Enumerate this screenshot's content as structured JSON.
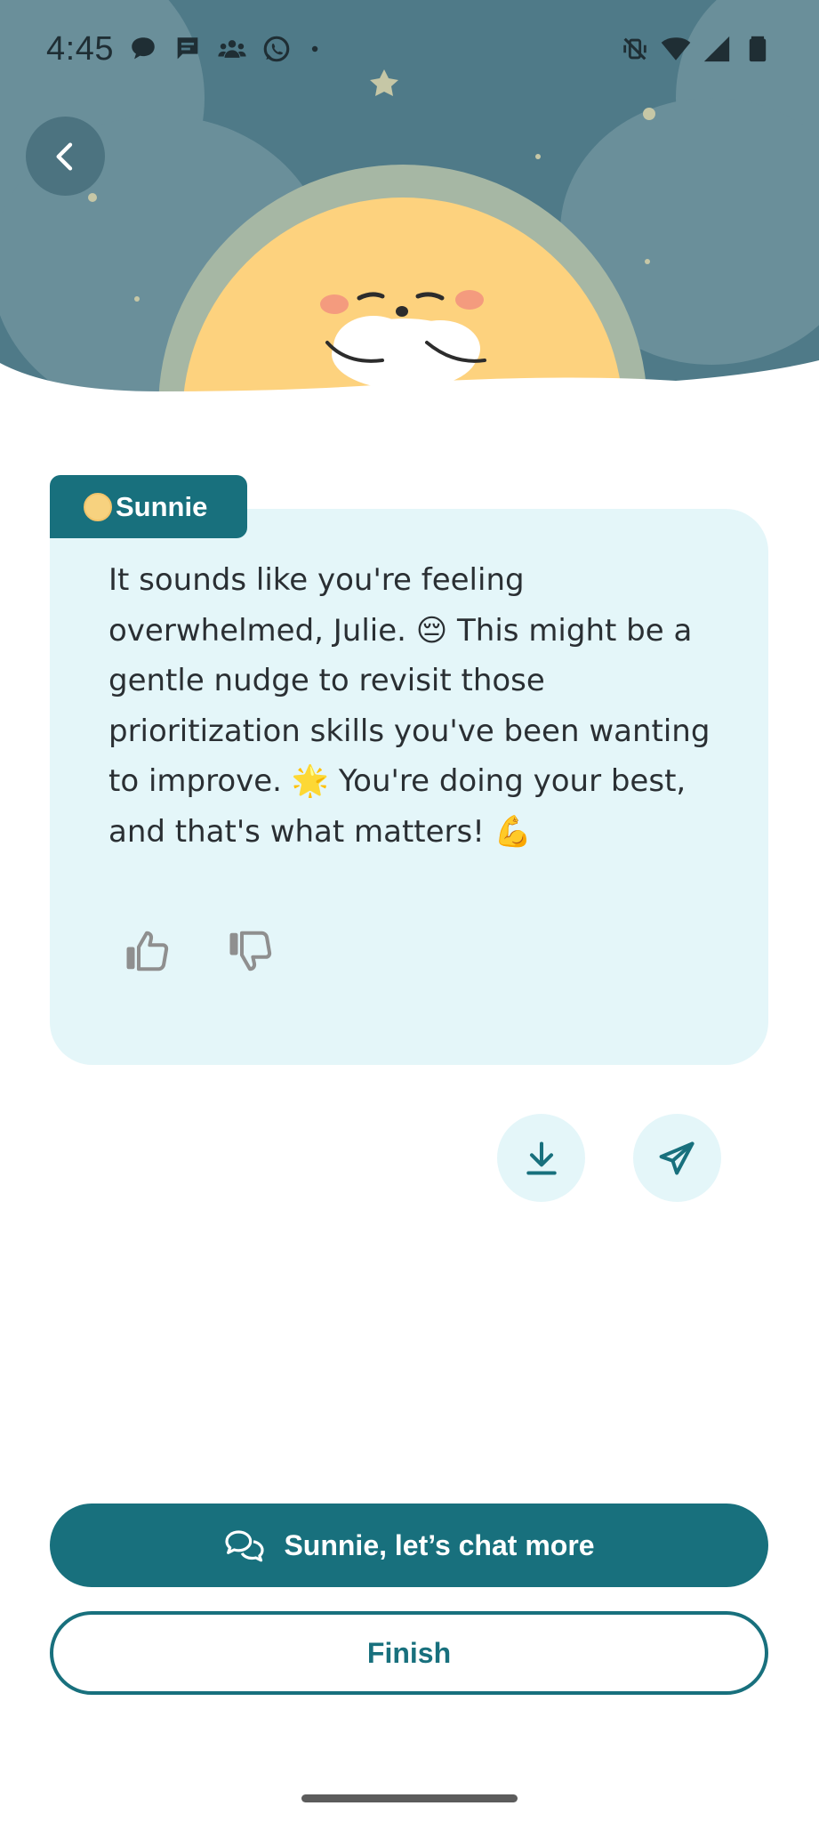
{
  "status_bar": {
    "time": "4:45",
    "left_icons": [
      "chat-bubble-icon",
      "message-icon",
      "group-icon",
      "whatsapp-icon",
      "dot-icon"
    ],
    "right_icons": [
      "vibrate-off-icon",
      "wifi-icon",
      "signal-icon",
      "battery-icon"
    ]
  },
  "header": {
    "back_icon": "chevron-left-icon",
    "illustration": "sleeping-sun-character"
  },
  "message": {
    "sender": "Sunnie",
    "text": "It sounds like you're feeling overwhelmed, Julie. 😔 This might be a gentle nudge to revisit those prioritization skills you've been wanting to improve. 🌟 You're doing your best, and that's what matters! 💪",
    "feedback_icons": [
      "thumbs-up-icon",
      "thumbs-down-icon"
    ]
  },
  "actions": {
    "download_icon": "download-icon",
    "share_icon": "send-icon"
  },
  "buttons": {
    "chat_more": "Sunnie, let’s chat more",
    "finish": "Finish"
  },
  "colors": {
    "primary": "#18707d",
    "card_bg": "#e4f6f9",
    "sky": "#4f7a88",
    "sun": "#fdd27e"
  }
}
